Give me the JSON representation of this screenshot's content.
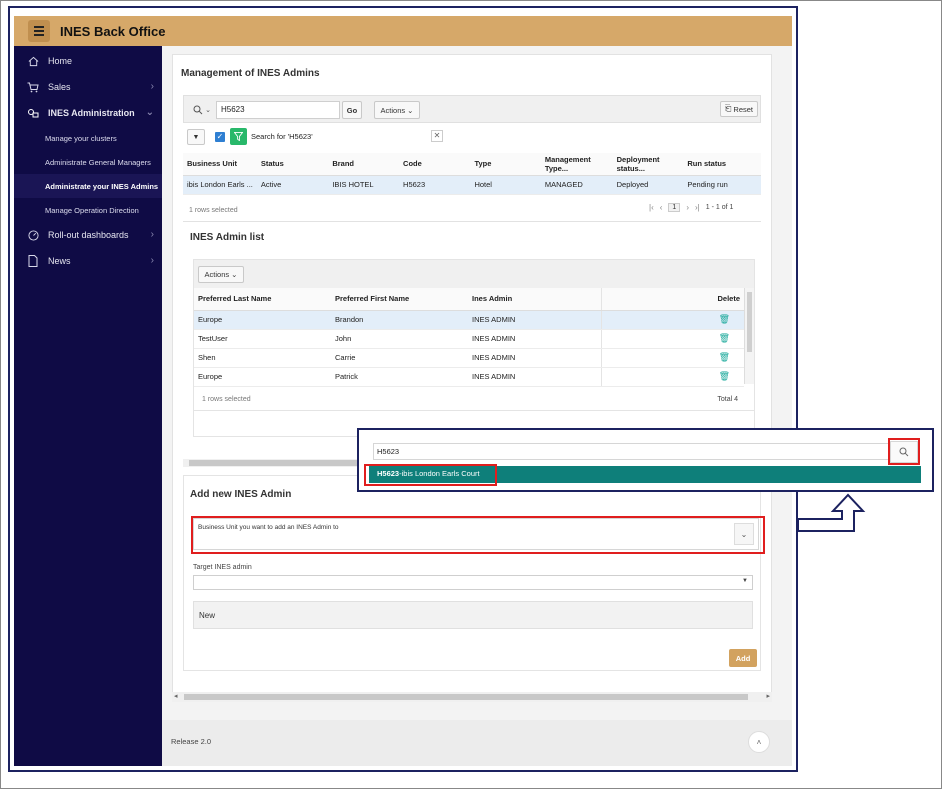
{
  "app": {
    "title": "INES Back Office"
  },
  "sidebar": {
    "items": [
      {
        "label": "Home",
        "icon": "home-icon"
      },
      {
        "label": "Sales",
        "icon": "cart-icon"
      },
      {
        "label": "INES Administration",
        "icon": "admin-icon"
      },
      {
        "label": "Roll-out dashboards",
        "icon": "gauge-icon"
      },
      {
        "label": "News",
        "icon": "document-icon"
      }
    ],
    "sub_items": [
      "Manage your clusters",
      "Administrate General Managers",
      "Administrate your INES Admins",
      "Manage Operation Direction"
    ]
  },
  "main": {
    "title": "Management of INES Admins",
    "search": {
      "value": "H5623",
      "go": "Go",
      "actions": "Actions",
      "reset": "Reset"
    },
    "filter": {
      "text": "Search for 'H5623'"
    },
    "bu_table": {
      "columns": [
        "Business Unit",
        "Status",
        "Brand",
        "Code",
        "Type",
        "Management Type...",
        "Deployment status...",
        "Run status"
      ],
      "rows": [
        [
          "ibis London Earls ...",
          "Active",
          "IBIS HOTEL",
          "H5623",
          "Hotel",
          "MANAGED",
          "Deployed",
          "Pending run"
        ]
      ],
      "selected": "1 rows selected",
      "page": "1",
      "range": "1 - 1 of 1"
    },
    "admin_list": {
      "title": "INES Admin list",
      "actions": "Actions",
      "columns": [
        "Preferred Last Name",
        "Preferred First Name",
        "Ines Admin",
        "Delete"
      ],
      "rows": [
        [
          "Europe",
          "Brandon",
          "INES ADMIN"
        ],
        [
          "TestUser",
          "John",
          "INES ADMIN"
        ],
        [
          "Shen",
          "Carrie",
          "INES ADMIN"
        ],
        [
          "Europe",
          "Patrick",
          "INES ADMIN"
        ]
      ],
      "selected": "1 rows selected",
      "total": "Total 4"
    },
    "add_admin": {
      "title": "Add new INES Admin",
      "bu_label": "Business Unit you want to add an INES Admin to",
      "target_label": "Target INES admin",
      "new_label": "New",
      "add": "Add"
    },
    "footer": {
      "release": "Release 2.0"
    }
  },
  "popup": {
    "search_value": "H5623",
    "result_code": "H5623",
    "result_name": "-ibis London Earls Court"
  },
  "colors": {
    "topbar": "#d6a869",
    "sidebar": "#0f0b45",
    "accent": "#0e7f7a",
    "highlight": "#e01e1e",
    "frame": "#1c2260"
  }
}
